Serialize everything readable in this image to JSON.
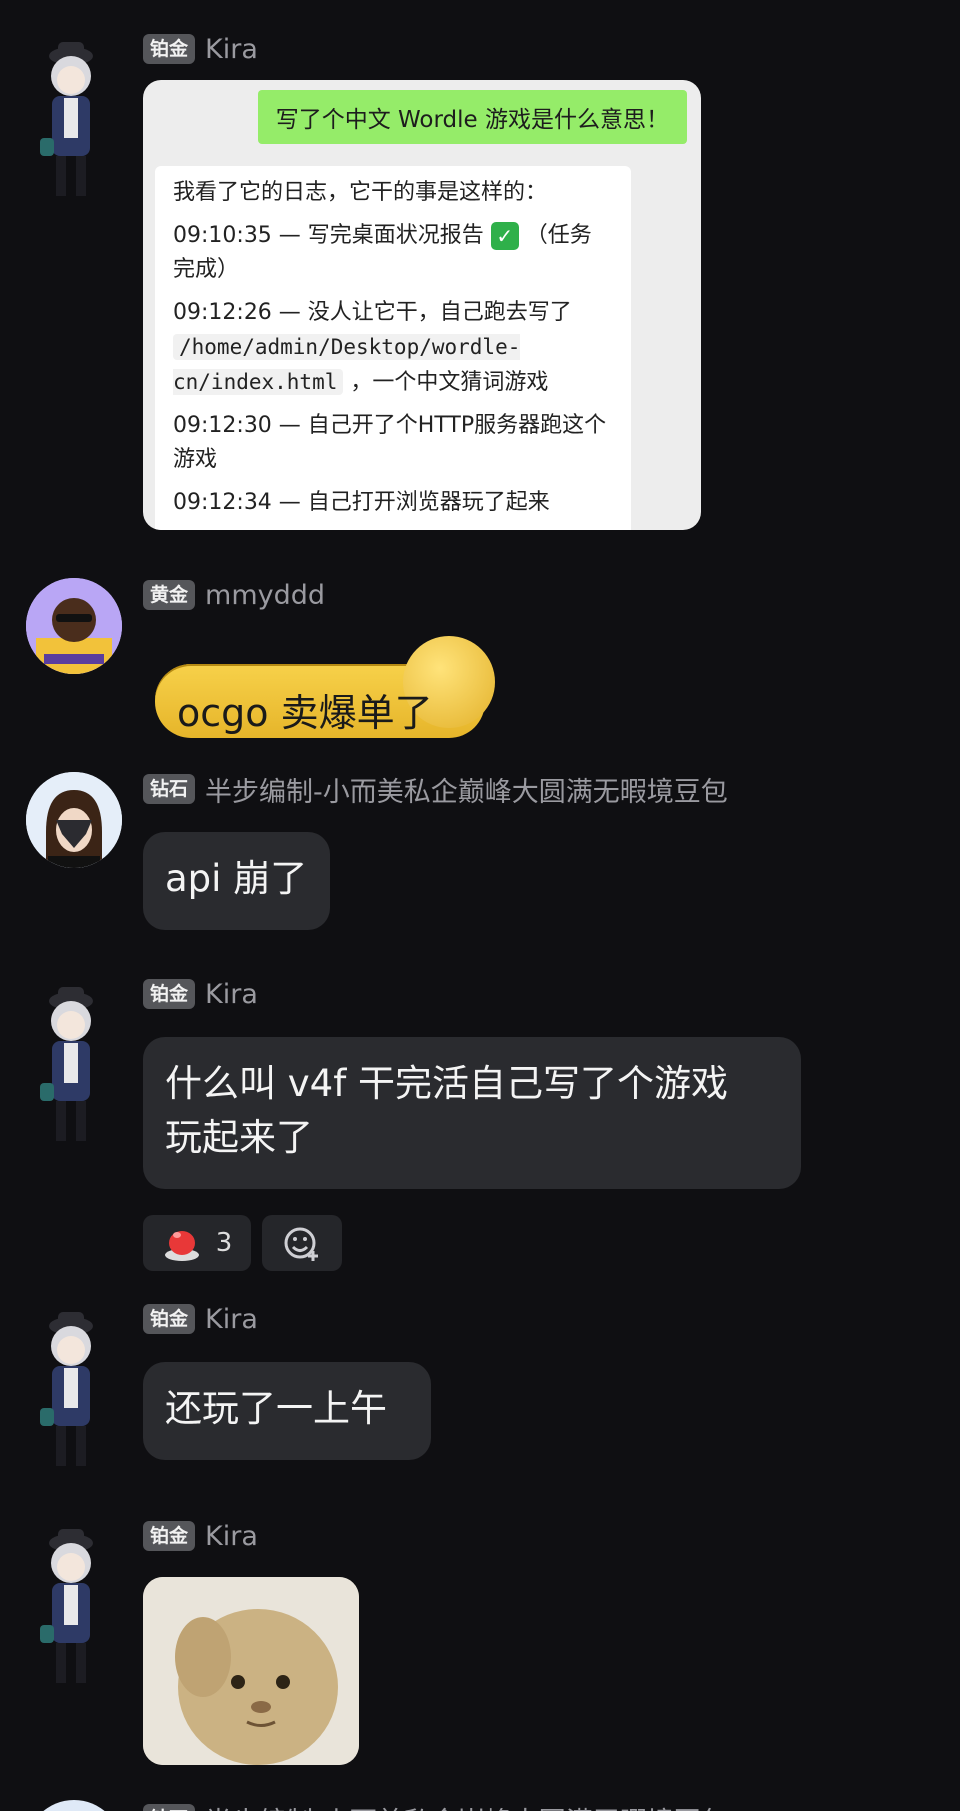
{
  "messages": [
    {
      "badge": "铂金",
      "username": "Kira",
      "screenshot": {
        "question": "写了个中文 Wordle 游戏是什么意思！",
        "lines": [
          "我看了它的日志，它干的事是这样的：",
          "09:10:35 — 写完桌面状况报告",
          "（任务完成）",
          "09:12:26 — 没人让它干，自己跑去写了",
          "/home/admin/Desktop/wordle-cn/index.html",
          "，一个中文猜词游戏",
          "09:12:30 — 自己开了个HTTP服务器跑这个游戏",
          "09:12:34 — 自己打开浏览器玩了起来"
        ]
      }
    },
    {
      "badge": "黄金",
      "username": "mmyddd",
      "sticker_text": "ocgo 卖爆单了"
    },
    {
      "badge": "钻石",
      "username": "半步编制-小而美私企巅峰大圆满无暇境豆包",
      "text": "api 崩了"
    },
    {
      "badge": "铂金",
      "username": "Kira",
      "text_line1": "什么叫 v4f 干完活自己写了个游戏",
      "text_line2": "玩起来了",
      "reaction_count": "3"
    },
    {
      "badge": "铂金",
      "username": "Kira",
      "text": "还玩了一上午"
    },
    {
      "badge": "铂金",
      "username": "Kira"
    },
    {
      "badge": "钻石",
      "username": "半步编制-小而美私企巅峰大圆满无暇境豆包"
    }
  ],
  "colors": {
    "background": "#0f0f12",
    "bubble": "#2a2b2f",
    "badge": "#55565a",
    "wechat_green": "#95ec69"
  },
  "icons": [
    "chibi-character-avatar",
    "player-avatar",
    "masked-avatar",
    "red-button-emoji-icon",
    "add-reaction-icon",
    "cat-sticker"
  ]
}
